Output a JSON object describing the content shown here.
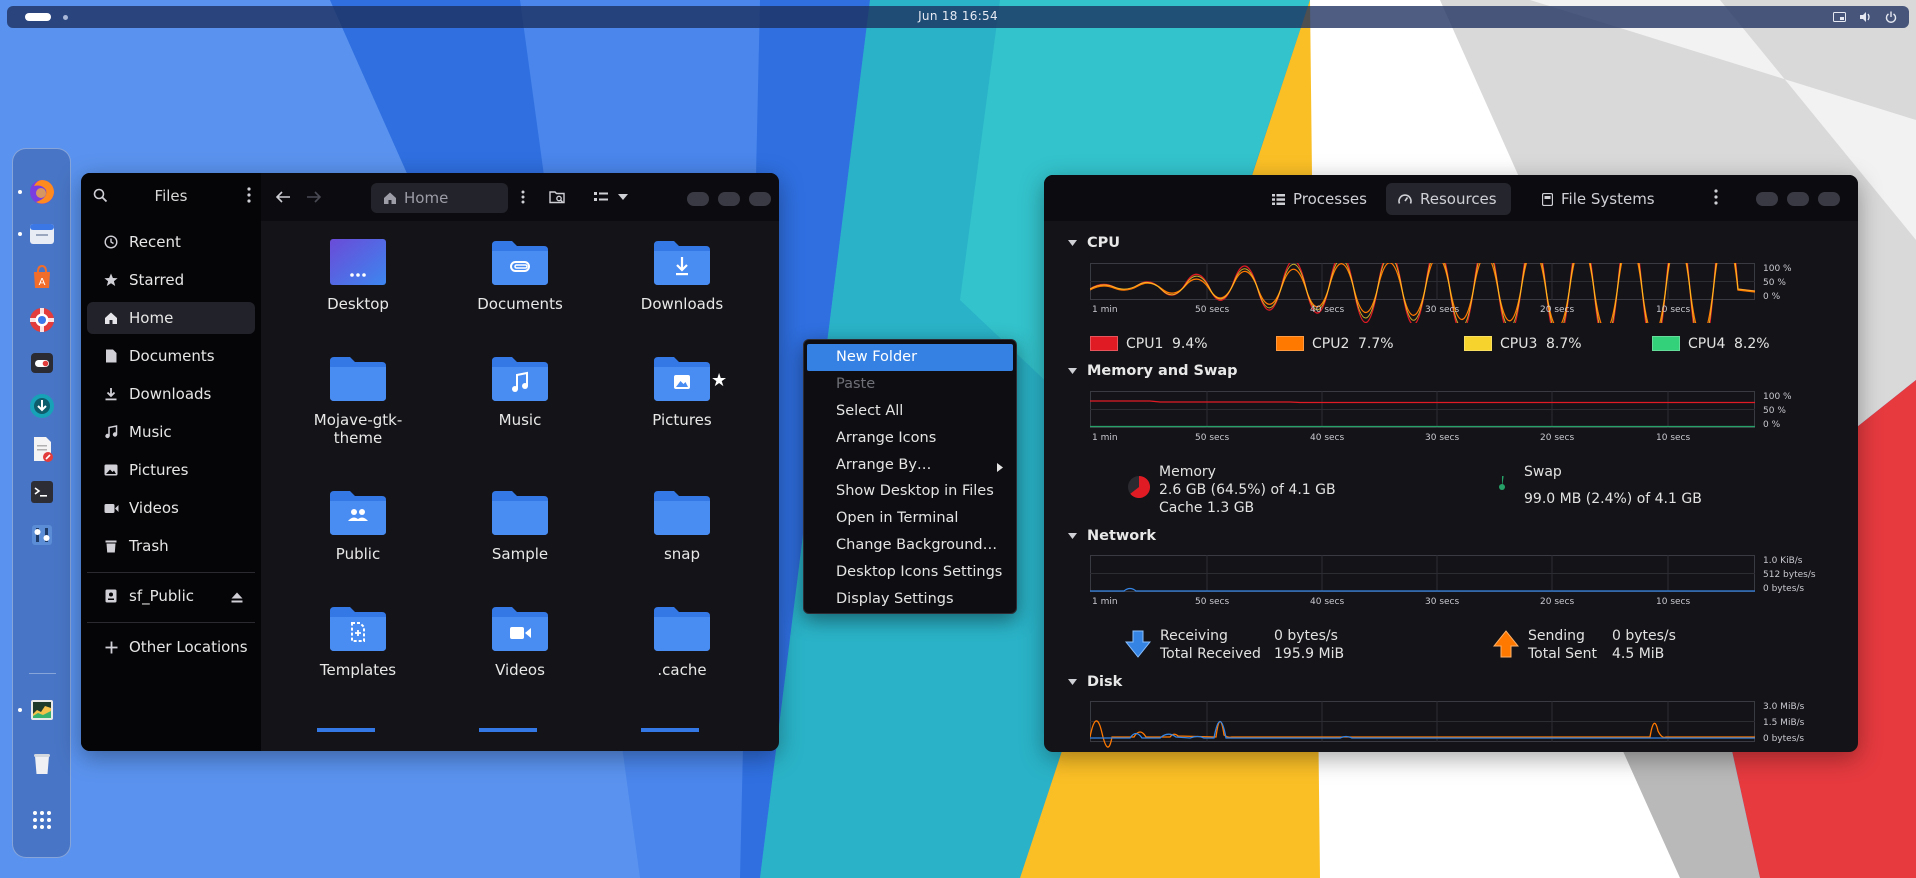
{
  "topbar": {
    "clock": "Jun 18  16:54"
  },
  "dock": {
    "items": [
      "firefox-icon",
      "files-icon",
      "app-center-icon",
      "help-icon",
      "toggle-app-icon",
      "updater-icon",
      "text-editor-icon",
      "terminal-icon",
      "settings-tweaks-icon",
      "system-monitor-icon",
      "trash-icon",
      "app-grid-icon"
    ]
  },
  "files": {
    "sidebar_title": "Files",
    "sidebar": [
      {
        "label": "Recent",
        "icon": "clock-icon"
      },
      {
        "label": "Starred",
        "icon": "star-icon"
      },
      {
        "label": "Home",
        "icon": "home-icon",
        "active": true
      },
      {
        "label": "Documents",
        "icon": "document-icon"
      },
      {
        "label": "Downloads",
        "icon": "download-icon"
      },
      {
        "label": "Music",
        "icon": "music-icon"
      },
      {
        "label": "Pictures",
        "icon": "picture-icon"
      },
      {
        "label": "Videos",
        "icon": "video-icon"
      },
      {
        "label": "Trash",
        "icon": "trash-icon"
      }
    ],
    "mount": "sf_Public",
    "other_locations": "Other Locations",
    "path": "Home",
    "folders": [
      {
        "label": "Desktop",
        "icon": "desktop-folder-icon"
      },
      {
        "label": "Documents",
        "icon": "documents-folder-icon"
      },
      {
        "label": "Downloads",
        "icon": "downloads-folder-icon"
      },
      {
        "label": "Mojave-gtk-\ntheme",
        "icon": "folder-icon"
      },
      {
        "label": "Music",
        "icon": "music-folder-icon"
      },
      {
        "label": "Pictures",
        "icon": "pictures-folder-icon",
        "starred": true
      },
      {
        "label": "Public",
        "icon": "public-folder-icon"
      },
      {
        "label": "Sample",
        "icon": "folder-icon"
      },
      {
        "label": "snap",
        "icon": "folder-icon"
      },
      {
        "label": "Templates",
        "icon": "templates-folder-icon"
      },
      {
        "label": "Videos",
        "icon": "videos-folder-icon"
      },
      {
        "label": ".cache",
        "icon": "folder-icon"
      }
    ]
  },
  "context_menu": {
    "items": [
      {
        "label": "New Folder",
        "state": "highlighted"
      },
      {
        "label": "Paste",
        "state": "disabled"
      },
      {
        "label": "Select All"
      },
      {
        "label": "Arrange Icons"
      },
      {
        "label": "Arrange By…",
        "submenu": true
      },
      {
        "label": "Show Desktop in Files"
      },
      {
        "label": "Open in Terminal"
      },
      {
        "label": "Change Background…"
      },
      {
        "label": "Desktop Icons Settings"
      },
      {
        "label": "Display Settings"
      }
    ]
  },
  "sysmon": {
    "tabs": [
      {
        "label": "Processes",
        "icon": "list-icon"
      },
      {
        "label": "Resources",
        "icon": "gauge-icon",
        "active": true
      },
      {
        "label": "File Systems",
        "icon": "disk-icon"
      }
    ],
    "time_labels": [
      "1 min",
      "50 secs",
      "40 secs",
      "30 secs",
      "20 secs",
      "10 secs"
    ],
    "cpu": {
      "title": "CPU",
      "y_labels": [
        "100 %",
        "50 %",
        "0 %"
      ],
      "cores": [
        {
          "label": "CPU1",
          "value": "9.4%",
          "color": "#e01b24"
        },
        {
          "label": "CPU2",
          "value": "7.7%",
          "color": "#ff7800"
        },
        {
          "label": "CPU3",
          "value": "8.7%",
          "color": "#f6d32d"
        },
        {
          "label": "CPU4",
          "value": "8.2%",
          "color": "#33d17a"
        }
      ]
    },
    "memory": {
      "title": "Memory and Swap",
      "y_labels": [
        "100 %",
        "50 %",
        "0 %"
      ],
      "memory_label": "Memory",
      "memory_value": "2.6 GB (64.5%) of 4.1 GB",
      "cache": "Cache 1.3 GB",
      "memory_percent": 64.5,
      "swap_label": "Swap",
      "swap_value": "99.0 MB (2.4%) of 4.1 GB",
      "swap_percent": 2.4,
      "memory_color": "#e01b24",
      "swap_color": "#26a269"
    },
    "network": {
      "title": "Network",
      "y_labels": [
        "1.0 KiB/s",
        "512 bytes/s",
        "0 bytes/s"
      ],
      "receiving_label": "Receiving",
      "receiving_value": "0 bytes/s",
      "total_received_label": "Total Received",
      "total_received_value": "195.9 MiB",
      "sending_label": "Sending",
      "sending_value": "0 bytes/s",
      "total_sent_label": "Total Sent",
      "total_sent_value": "4.5 MiB"
    },
    "disk": {
      "title": "Disk",
      "y_labels": [
        "3.0 MiB/s",
        "1.5 MiB/s",
        "0 bytes/s"
      ]
    }
  }
}
